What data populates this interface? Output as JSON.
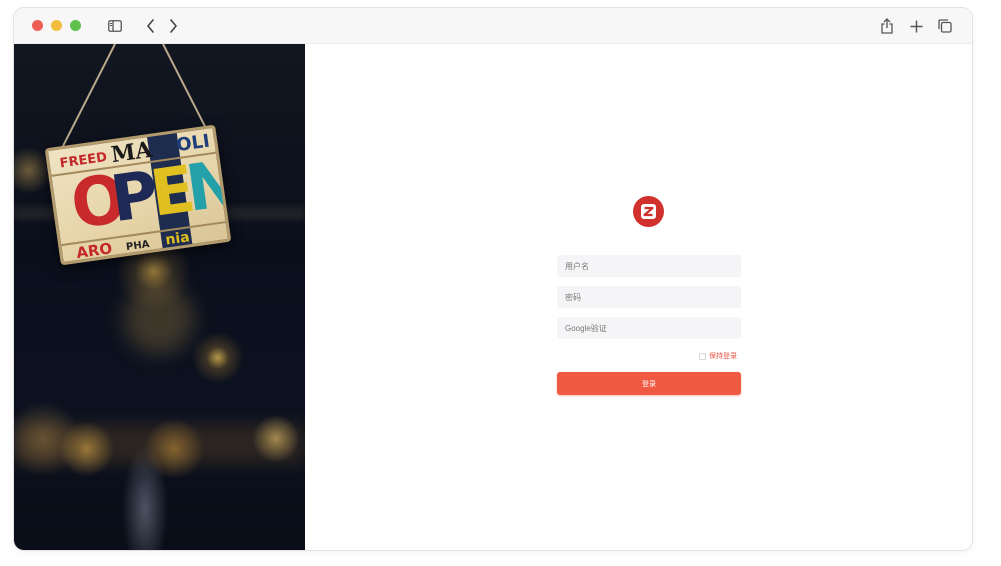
{
  "browser": {
    "icons": {
      "sidebar": "sidebar-icon",
      "back": "chevron-left-icon",
      "forward": "chevron-right-icon",
      "share": "share-icon",
      "new_tab": "plus-icon",
      "tabs": "tabs-overview-icon"
    }
  },
  "hero_image": {
    "sign_text": {
      "top_left": "FREED",
      "top_mid": "MA",
      "top_right": "OLI",
      "big_o": "O",
      "big_p": "P",
      "big_e": "E",
      "big_n": "N",
      "bottom_left": "ARO",
      "bottom_mid": "PHA",
      "bottom_right": "nia"
    }
  },
  "login": {
    "logo_letter": "Z",
    "logo_color": "#d0312d",
    "username_placeholder": "用户名",
    "password_placeholder": "密码",
    "google_placeholder": "Google验证",
    "remember_label": "保持登录",
    "submit_label": "登录",
    "accent_color": "#f05a42"
  }
}
